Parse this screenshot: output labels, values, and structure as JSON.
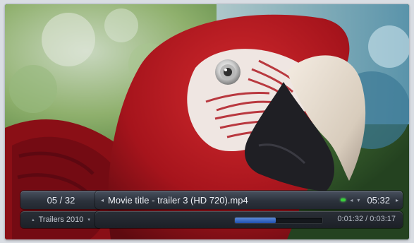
{
  "osd": {
    "count_text": "05 / 32",
    "category_label": "Trailers 2010",
    "title": "Movie title - trailer 3 (HD 720).mp4",
    "clock": "05:32",
    "time_text": "0:01:32 / 0:03:17",
    "progress_fraction": 0.47
  },
  "icons": {
    "left_arrow": "◂",
    "right_arrow": "▸",
    "up_arrow": "▴",
    "down_arrow": "▾",
    "status_arrow": "◂",
    "status_drop": "▾"
  },
  "colors": {
    "progress_blue": "#2d63c6",
    "indicator_green": "#38d13a"
  }
}
